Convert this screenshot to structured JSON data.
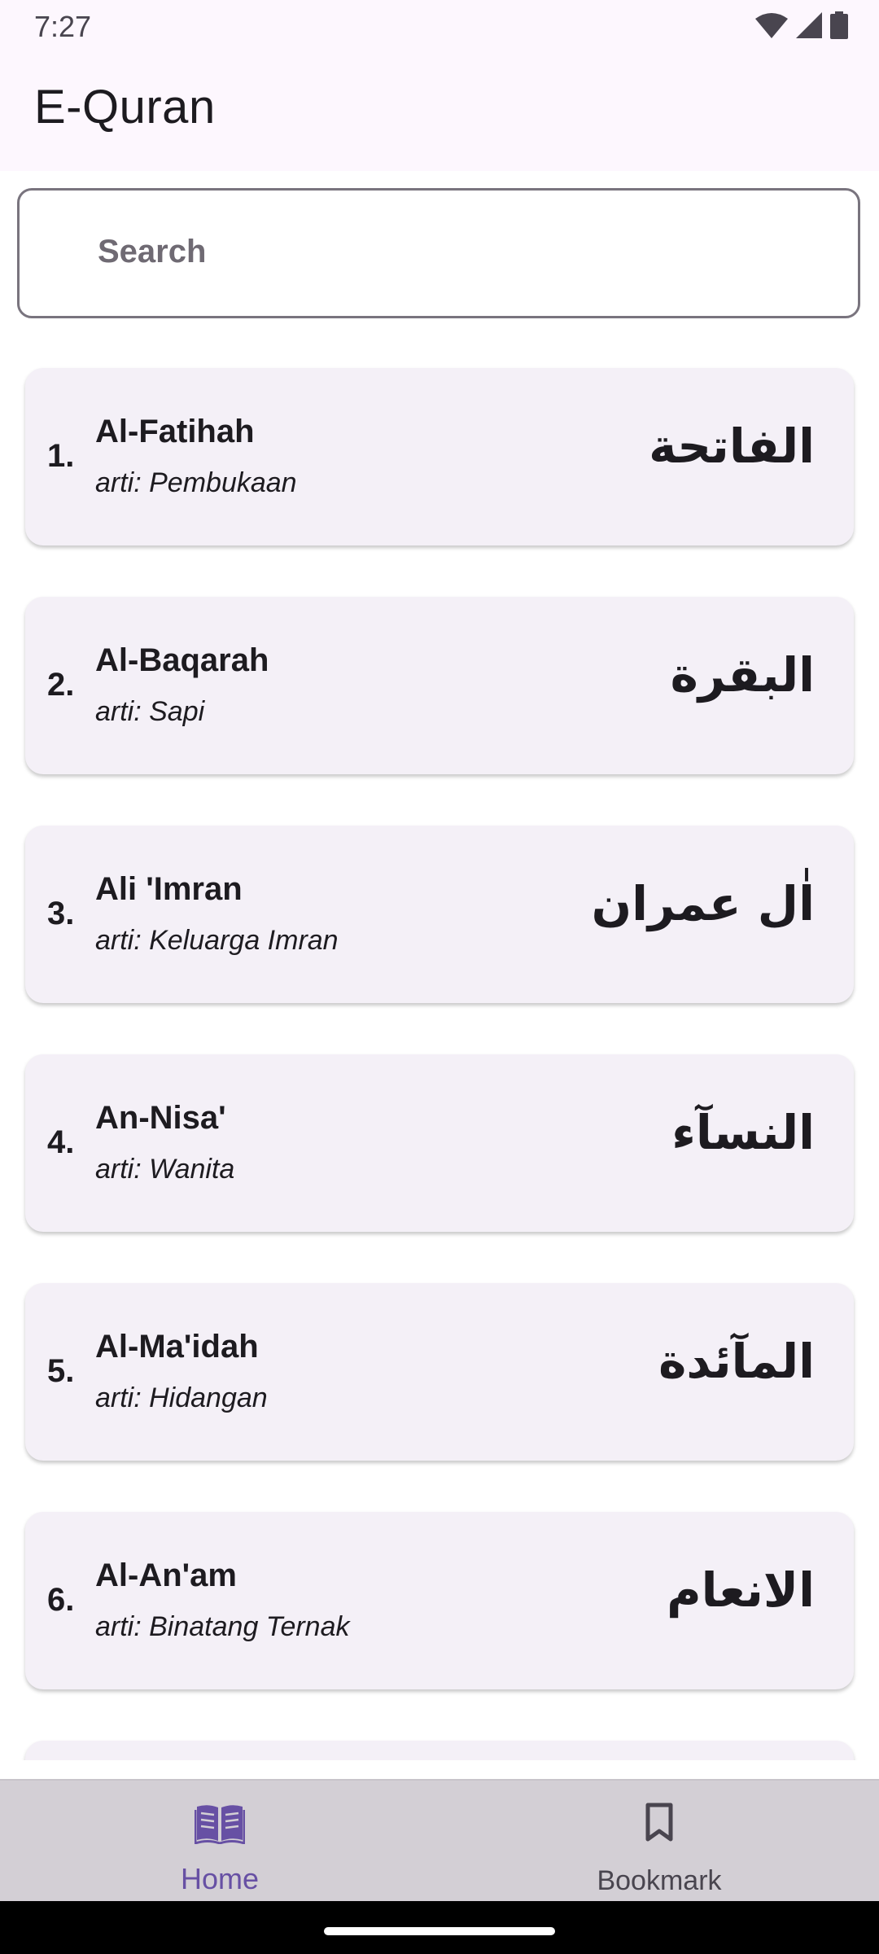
{
  "status_bar": {
    "time": "7:27"
  },
  "app_bar": {
    "title": "E-Quran"
  },
  "search": {
    "placeholder": "Search",
    "value": ""
  },
  "surahs": [
    {
      "number": "1.",
      "latin": "Al-Fatihah",
      "arti": "arti: Pembukaan",
      "arabic": "الفاتحة"
    },
    {
      "number": "2.",
      "latin": "Al-Baqarah",
      "arti": "arti: Sapi",
      "arabic": "البقرة"
    },
    {
      "number": "3.",
      "latin": "Ali 'Imran",
      "arti": "arti: Keluarga Imran",
      "arabic": "اٰل عمران"
    },
    {
      "number": "4.",
      "latin": "An-Nisa'",
      "arti": "arti: Wanita",
      "arabic": "النسآء"
    },
    {
      "number": "5.",
      "latin": "Al-Ma'idah",
      "arti": "arti: Hidangan",
      "arabic": "المآئدة"
    },
    {
      "number": "6.",
      "latin": "Al-An'am",
      "arti": "arti: Binatang Ternak",
      "arabic": "الانعام"
    }
  ],
  "bottom_nav": {
    "items": [
      {
        "label": "Home",
        "icon": "book-icon",
        "selected": true
      },
      {
        "label": "Bookmark",
        "icon": "bookmark-icon",
        "selected": false
      }
    ]
  },
  "colors": {
    "accent": "#6750a4",
    "card_background": "#f4f0f7",
    "nav_background": "#d3cfd5",
    "app_bar_background": "#fdf7fe"
  }
}
